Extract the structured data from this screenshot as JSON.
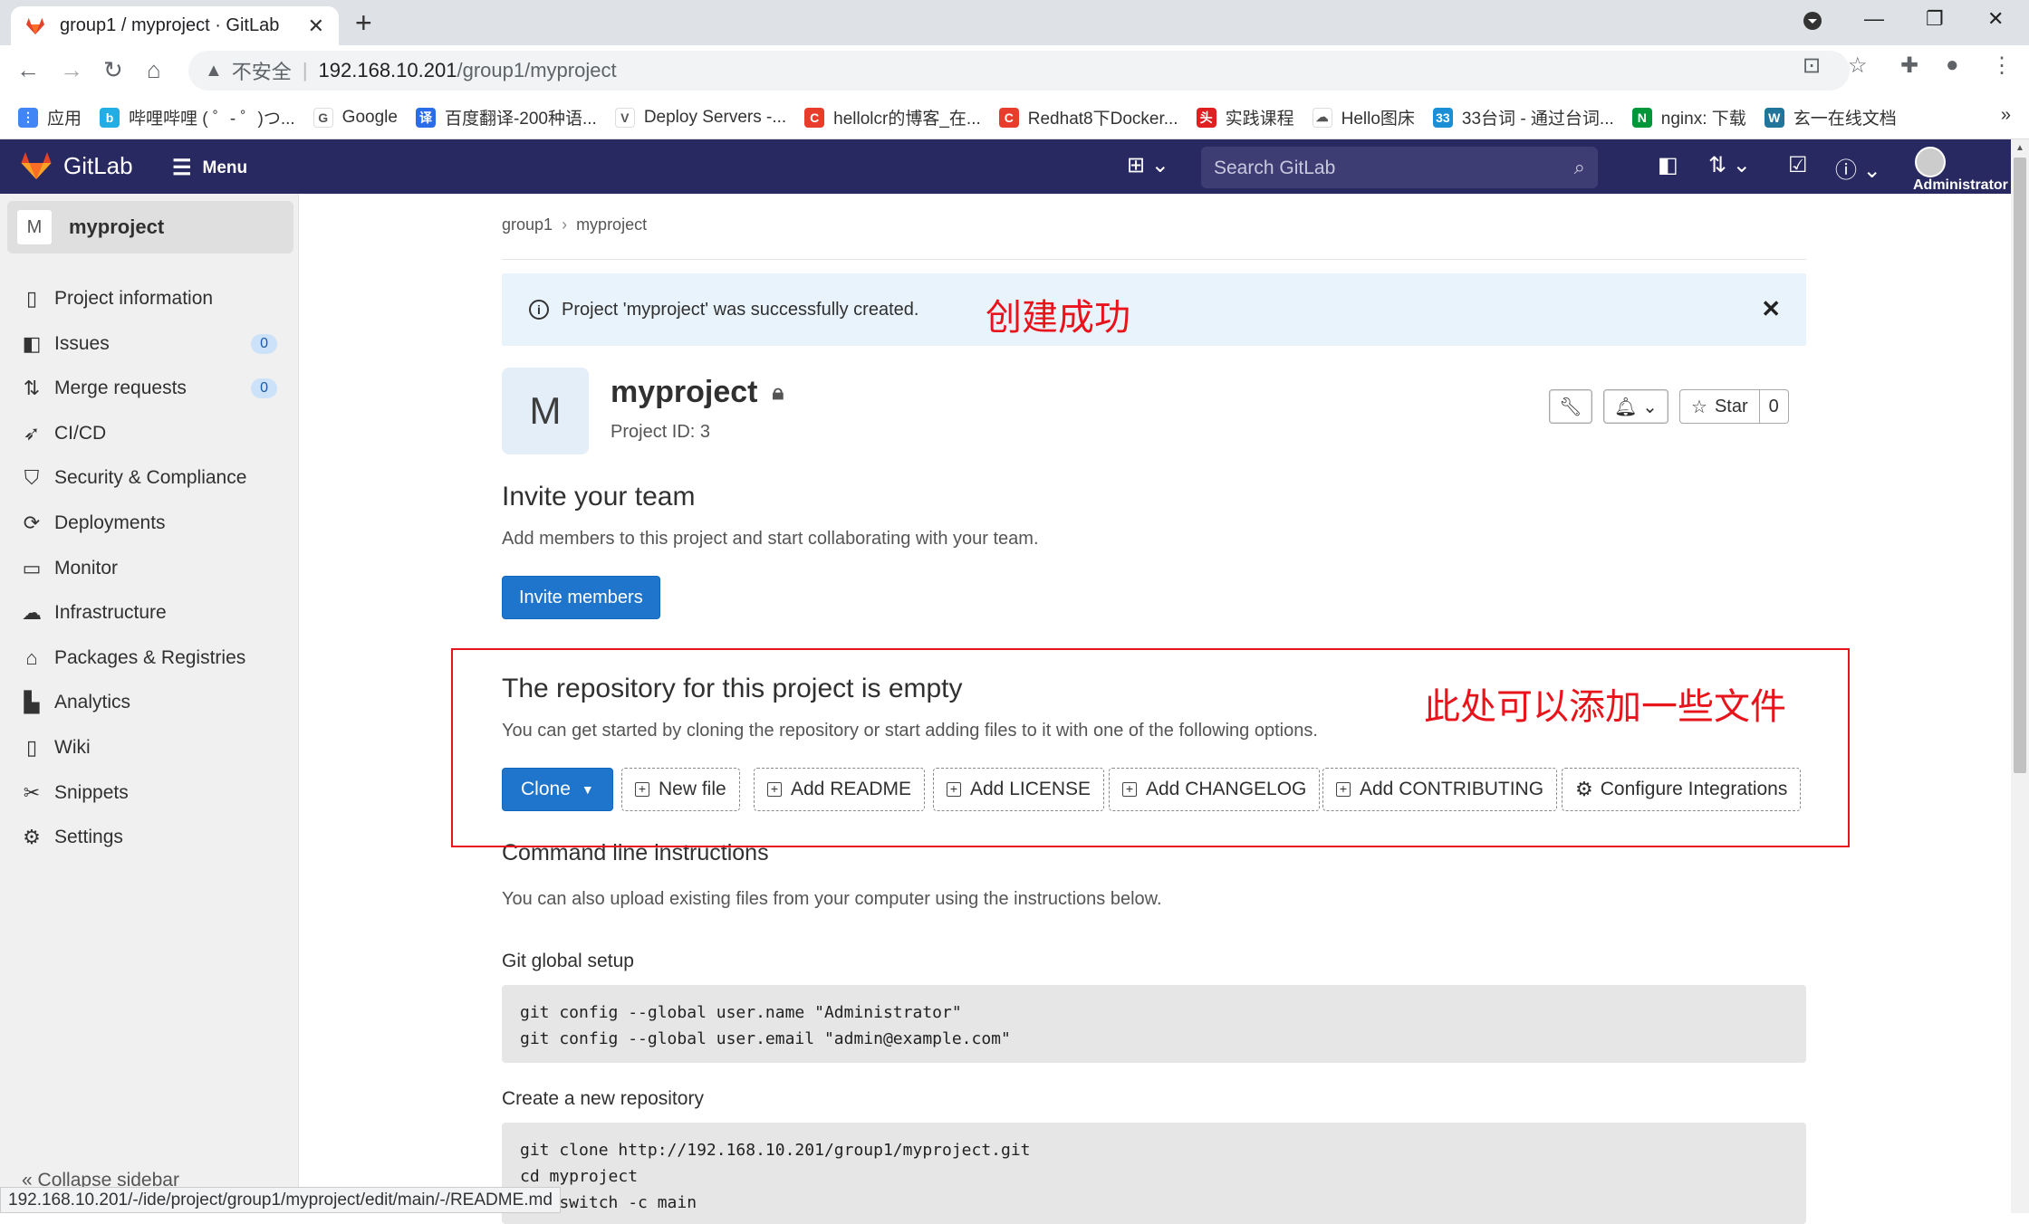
{
  "browser": {
    "tab_title": "group1 / myproject · GitLab",
    "tab_close": "✕",
    "new_tab": "+",
    "url_warning": "不安全",
    "url_host": "192.168.10.201",
    "url_path": "/group1/myproject",
    "bookmarks": [
      {
        "label": "应用",
        "color": "#4285f4",
        "glyph": "⋮"
      },
      {
        "label": "哔哩哔哩 ( ゜- ゜)つ...",
        "color": "#23ade5",
        "glyph": "b"
      },
      {
        "label": "Google",
        "color": "#ffffff",
        "glyph": "G"
      },
      {
        "label": "百度翻译-200种语...",
        "color": "#2b6de9",
        "glyph": "译"
      },
      {
        "label": "Deploy Servers -...",
        "color": "#ffffff",
        "glyph": "V"
      },
      {
        "label": "hellolcr的博客_在...",
        "color": "#e83d2d",
        "glyph": "C"
      },
      {
        "label": "Redhat8下Docker...",
        "color": "#e83d2d",
        "glyph": "C"
      },
      {
        "label": "实践课程",
        "color": "#e02020",
        "glyph": "头"
      },
      {
        "label": "Hello图床",
        "color": "#ffffff",
        "glyph": "☁"
      },
      {
        "label": "33台词 - 通过台词...",
        "color": "#1a8fd6",
        "glyph": "33"
      },
      {
        "label": "nginx: 下载",
        "color": "#009639",
        "glyph": "N"
      },
      {
        "label": "玄一在线文档",
        "color": "#21759b",
        "glyph": "W"
      }
    ],
    "bookmarks_more": "»",
    "status_url": "192.168.10.201/-/ide/project/group1/myproject/edit/main/-/README.md"
  },
  "gitlab_header": {
    "brand": "GitLab",
    "menu_label": "Menu",
    "search_placeholder": "Search GitLab",
    "user_label": "Administrator"
  },
  "sidebar": {
    "project_initial": "M",
    "project_name": "myproject",
    "items": [
      {
        "label": "Project information",
        "icon": "project-icon",
        "glyph": "▯"
      },
      {
        "label": "Issues",
        "icon": "issues-icon",
        "glyph": "◧",
        "badge": "0"
      },
      {
        "label": "Merge requests",
        "icon": "merge-request-icon",
        "glyph": "⇅",
        "badge": "0"
      },
      {
        "label": "CI/CD",
        "icon": "rocket-icon",
        "glyph": "➶"
      },
      {
        "label": "Security & Compliance",
        "icon": "shield-icon",
        "glyph": "⛉"
      },
      {
        "label": "Deployments",
        "icon": "deployments-icon",
        "glyph": "⟳"
      },
      {
        "label": "Monitor",
        "icon": "monitor-icon",
        "glyph": "▭"
      },
      {
        "label": "Infrastructure",
        "icon": "cloud-icon",
        "glyph": "☁"
      },
      {
        "label": "Packages & Registries",
        "icon": "package-icon",
        "glyph": "⌂"
      },
      {
        "label": "Analytics",
        "icon": "chart-icon",
        "glyph": "▙"
      },
      {
        "label": "Wiki",
        "icon": "book-icon",
        "glyph": "▯"
      },
      {
        "label": "Snippets",
        "icon": "scissors-icon",
        "glyph": "✂"
      },
      {
        "label": "Settings",
        "icon": "gear-icon",
        "glyph": "⚙"
      }
    ],
    "collapse_label": "Collapse sidebar"
  },
  "main": {
    "breadcrumbs": [
      "group1",
      "myproject"
    ],
    "alert_text": "Project 'myproject' was successfully created.",
    "annotation_created": "创建成功",
    "project_initial": "M",
    "project_name": "myproject",
    "project_id": "Project ID: 3",
    "star_label": "Star",
    "star_count": "0",
    "invite_title": "Invite your team",
    "invite_desc": "Add members to this project and start collaborating with your team.",
    "invite_button": "Invite members",
    "empty_title": "The repository for this project is empty",
    "empty_desc": "You can get started by cloning the repository or start adding files to it with one of the following options.",
    "annotation_files": "此处可以添加一些文件",
    "clone_button": "Clone",
    "file_buttons": [
      "New file",
      "Add README",
      "Add LICENSE",
      "Add CHANGELOG",
      "Add CONTRIBUTING",
      "Configure Integrations"
    ],
    "cli_title": "Command line instructions",
    "cli_desc": "You can also upload existing files from your computer using the instructions below.",
    "git_global_title": "Git global setup",
    "git_global_code": "git config --global user.name \"Administrator\"\ngit config --global user.email \"admin@example.com\"",
    "new_repo_title": "Create a new repository",
    "new_repo_code": "git clone http://192.168.10.201/group1/myproject.git\ncd myproject\ngit switch -c main"
  }
}
